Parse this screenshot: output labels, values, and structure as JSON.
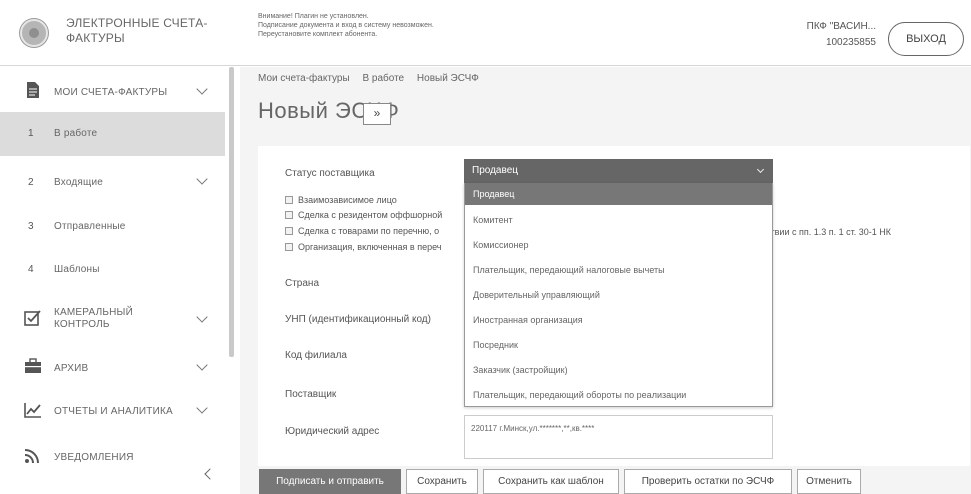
{
  "header": {
    "app_title": "ЭЛЕКТРОННЫЕ СЧЕТА-ФАКТУРЫ",
    "warning_lines": [
      "Внимание! Плагин не установлен.",
      "Подписание документа и вход в систему невозможен.",
      "Переустановите комплект абонента."
    ],
    "user_name": "ПКФ \"ВАСИН...",
    "user_id": "100235855",
    "logout_label": "ВЫХОД"
  },
  "sidebar": {
    "items": [
      {
        "label": "МОИ СЧЕТА-ФАКТУРЫ",
        "icon": "document-icon"
      },
      {
        "num": "1",
        "label": "В работе"
      },
      {
        "num": "2",
        "label": "Входящие"
      },
      {
        "num": "3",
        "label": "Отправленные"
      },
      {
        "num": "4",
        "label": "Шаблоны"
      },
      {
        "label": "КАМЕРАЛЬНЫЙ КОНТРОЛЬ",
        "icon": "check-box-icon"
      },
      {
        "label": "АРХИВ",
        "icon": "briefcase-icon"
      },
      {
        "label": "ОТЧЕТЫ И АНАЛИТИКА",
        "icon": "chart-icon"
      },
      {
        "label": "УВЕДОМЛЕНИЯ",
        "icon": "rss-icon"
      }
    ]
  },
  "breadcrumb": [
    "Мои счета-фактуры",
    "В работе",
    "Новый ЭСЧФ"
  ],
  "page_title": "Новый ЭСЧФ",
  "expand_label": "»",
  "form": {
    "status_label": "Статус поставщика",
    "status_value": "Продавец",
    "checkboxes": [
      "Взаимозависимое лицо",
      "Сделка с резидентом оффшорной",
      "Сделка с товарами по перечню, о",
      "Организация, включенная в переч"
    ],
    "extra_text": "тствии с пп. 1.3 п. 1 ст. 30-1 НК",
    "fields": [
      "Страна",
      "УНП (идентификационный код)",
      "Код филиала",
      "Поставщик",
      "Юридический адрес"
    ],
    "address_value": "220117 г.Минск,ул.*******,**,кв.****",
    "dropdown_options": [
      "Продавец",
      "Комитент",
      "Комиссионер",
      "Плательщик, передающий налоговые вычеты",
      "Доверительный управляющий",
      "Иностранная организация",
      "Посредник",
      "Заказчик (застройщик)",
      "Плательщик, передающий обороты по реализации"
    ]
  },
  "actions": {
    "sign": "Подписать и отправить",
    "save": "Сохранить",
    "save_template": "Сохранить как шаблон",
    "check_balance": "Проверить остатки по ЭСЧФ",
    "cancel": "Отменить"
  }
}
